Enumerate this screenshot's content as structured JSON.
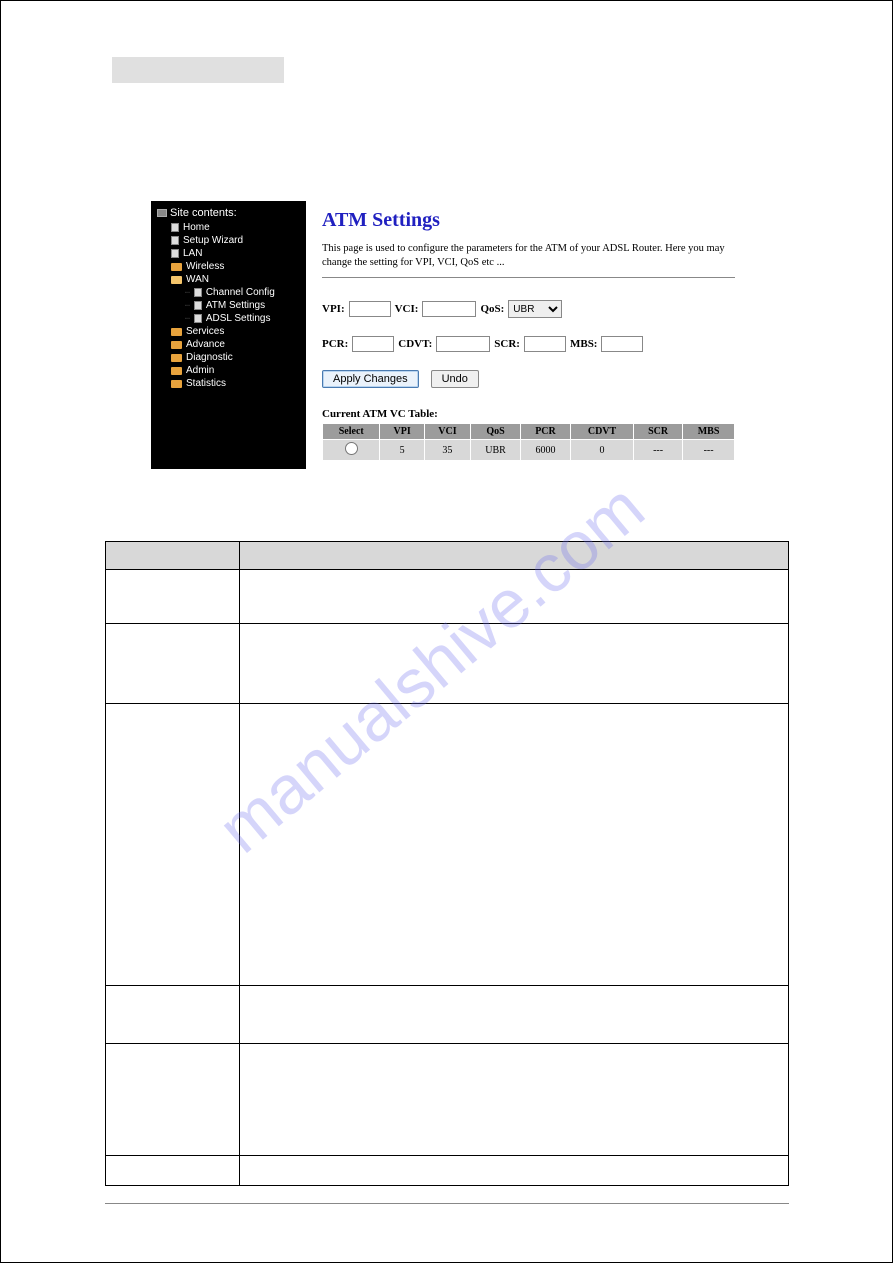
{
  "watermark": "manualshive.com",
  "sidebar": {
    "title": "Site contents:",
    "items": [
      {
        "label": "Home",
        "icon": "file"
      },
      {
        "label": "Setup Wizard",
        "icon": "file"
      },
      {
        "label": "LAN",
        "icon": "file"
      },
      {
        "label": "Wireless",
        "icon": "folder"
      },
      {
        "label": "WAN",
        "icon": "folder-open",
        "children": [
          {
            "label": "Channel Config",
            "icon": "file"
          },
          {
            "label": "ATM Settings",
            "icon": "file"
          },
          {
            "label": "ADSL Settings",
            "icon": "file"
          }
        ]
      },
      {
        "label": "Services",
        "icon": "folder"
      },
      {
        "label": "Advance",
        "icon": "folder"
      },
      {
        "label": "Diagnostic",
        "icon": "folder"
      },
      {
        "label": "Admin",
        "icon": "folder"
      },
      {
        "label": "Statistics",
        "icon": "folder"
      }
    ]
  },
  "content": {
    "title": "ATM Settings",
    "description": "This page is used to configure the parameters for the ATM of your ADSL Router. Here you may change the setting for VPI, VCI, QoS etc ...",
    "labels": {
      "vpi": "VPI:",
      "vci": "VCI:",
      "qos": "QoS:",
      "pcr": "PCR:",
      "cdvt": "CDVT:",
      "scr": "SCR:",
      "mbs": "MBS:"
    },
    "qos_selected": "UBR",
    "buttons": {
      "apply": "Apply Changes",
      "undo": "Undo"
    },
    "table_caption": "Current ATM VC Table:",
    "table_headers": [
      "Select",
      "VPI",
      "VCI",
      "QoS",
      "PCR",
      "CDVT",
      "SCR",
      "MBS"
    ],
    "table_rows": [
      {
        "select": false,
        "vpi": "5",
        "vci": "35",
        "qos": "UBR",
        "pcr": "6000",
        "cdvt": "0",
        "scr": "---",
        "mbs": "---"
      }
    ]
  }
}
